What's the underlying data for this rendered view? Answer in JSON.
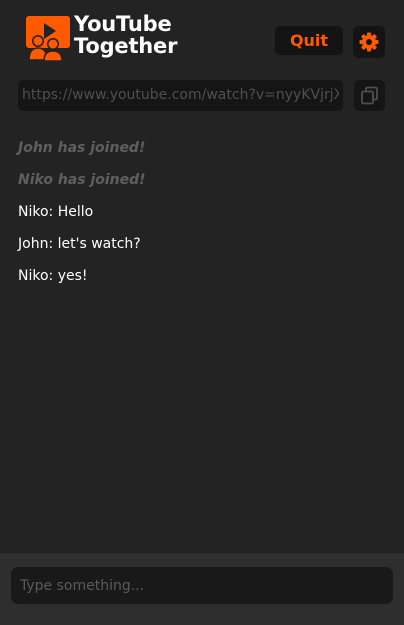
{
  "header": {
    "logo_line1": "YouTube",
    "logo_line2": "Together",
    "quit_label": "Quit",
    "settings_icon": "gear-icon"
  },
  "url_bar": {
    "value": "https://www.youtube.com/watch?v=nyyKVjrjXF",
    "copy_icon": "copy-icon"
  },
  "messages": [
    {
      "type": "system",
      "text": "John has joined!"
    },
    {
      "type": "system",
      "text": "Niko has joined!"
    },
    {
      "type": "chat",
      "text": "Niko: Hello"
    },
    {
      "type": "chat",
      "text": "John: let's watch?"
    },
    {
      "type": "chat",
      "text": "Niko: yes!"
    }
  ],
  "composer": {
    "placeholder": "Type something..."
  },
  "colors": {
    "accent": "#ff5a00",
    "background": "#232323",
    "footer": "#2e2e2e"
  }
}
